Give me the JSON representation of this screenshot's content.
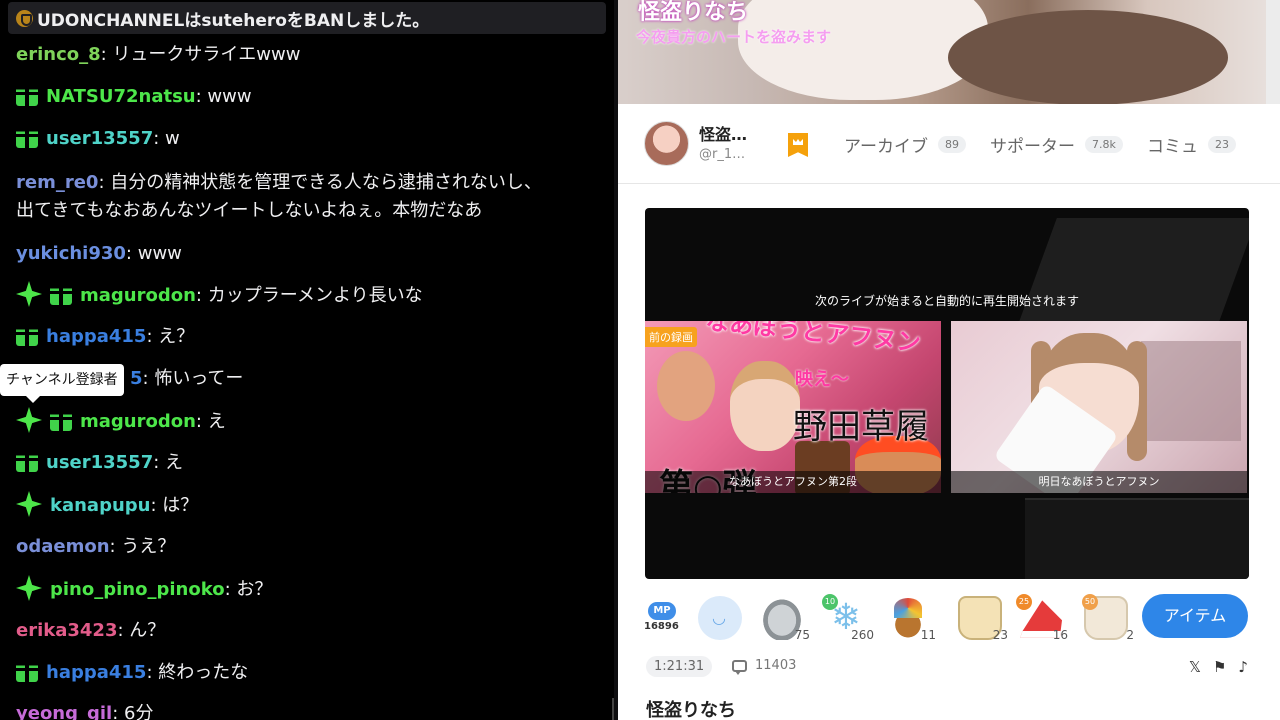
{
  "chat": {
    "notice": "UDONCHANNELはsuteheroをBANしました。",
    "messages": [
      {
        "user": "erinco_8",
        "color": "#7fd35a",
        "badges": [],
        "text": "リュークサライエwww"
      },
      {
        "user": "NATSU72natsu",
        "color": "#4de64a",
        "badges": [
          "gift"
        ],
        "text": "www"
      },
      {
        "user": "user13557",
        "color": "#4fd3c8",
        "badges": [
          "gift"
        ],
        "text": "w"
      },
      {
        "user": "rem_re0",
        "color": "#7a8fd8",
        "badges": [],
        "text": "自分の精神状態を管理できる人なら逮捕されないし、",
        "text2": "出てきてもなおあんなツイートしないよねぇ。本物だなあ"
      },
      {
        "user": "yukichi930",
        "color": "#6b8fe0",
        "badges": [],
        "text": "www"
      },
      {
        "user": "magurodon",
        "color": "#4de64a",
        "badges": [
          "star",
          "gift"
        ],
        "text": "カップラーメンより長いな"
      },
      {
        "user": "happa415",
        "color": "#3a7fe0",
        "badges": [
          "gift"
        ],
        "text": "え？"
      },
      {
        "user": "5",
        "color": "#3a7fe0",
        "badges": [],
        "text": "怖いってー"
      },
      {
        "user": "magurodon",
        "color": "#4de64a",
        "badges": [
          "star",
          "gift"
        ],
        "text": "え"
      },
      {
        "user": "user13557",
        "color": "#4fd3c8",
        "badges": [
          "gift"
        ],
        "text": "え"
      },
      {
        "user": "kanapupu",
        "color": "#4fd3c8",
        "badges": [
          "star"
        ],
        "text": "は？"
      },
      {
        "user": "odaemon",
        "color": "#7a8fd8",
        "badges": [],
        "text": "うえ？"
      },
      {
        "user": "pino_pino_pinoko",
        "color": "#4de64a",
        "badges": [
          "star"
        ],
        "text": "お？"
      },
      {
        "user": "erika3423",
        "color": "#e25c8a",
        "badges": [],
        "text": "ん？"
      },
      {
        "user": "happa415",
        "color": "#3a7fe0",
        "badges": [
          "gift"
        ],
        "text": "終わったな"
      },
      {
        "user": "yeong_gil",
        "color": "#c66bd8",
        "badges": [],
        "text": "6分"
      }
    ],
    "tooltip": "チャンネル登録者"
  },
  "banner": {
    "title": "怪盗りなち",
    "subtitle": "今夜貴方のハートを盗みます"
  },
  "profile": {
    "name": "怪盗…",
    "handle": "@r_1…",
    "tabs": [
      {
        "label": "アーカイブ",
        "count": "89"
      },
      {
        "label": "サポーター",
        "count": "7.8k"
      },
      {
        "label": "コミュ",
        "count": "23"
      }
    ]
  },
  "player": {
    "next_text": "次のライブが始まると自動的に再生開始されます",
    "thumb1": {
      "tag": "前の録画",
      "pink_text": "なあぼうとアフヌン",
      "pink_text2": "映え〜",
      "big_text": "野田草履",
      "black_text": "第○弾",
      "caption": "なあぼうとアフヌン第2段"
    },
    "thumb2": {
      "caption": "明日なあぼうとアフヌン"
    }
  },
  "gifts": {
    "mp_label": "MP",
    "mp_value": "16896",
    "items": [
      {
        "icon": "smile-icon",
        "count": ""
      },
      {
        "icon": "disc-icon",
        "count": "75"
      },
      {
        "icon": "snowflake-icon",
        "count": "260",
        "level": "10",
        "level_color": "#4cc46a"
      },
      {
        "icon": "rocket-icon",
        "count": "11"
      },
      {
        "icon": "cup-icon",
        "count": "23"
      },
      {
        "icon": "santa-hat-icon",
        "count": "16",
        "level": "25",
        "level_color": "#f08a2a"
      },
      {
        "icon": "cup2-icon",
        "count": "2",
        "level": "50",
        "level_color": "#f0a04a"
      }
    ],
    "item_button": "アイテム"
  },
  "meta": {
    "duration": "1:21:31",
    "comments": "11403"
  },
  "footer": {
    "title": "怪盗りなち"
  }
}
